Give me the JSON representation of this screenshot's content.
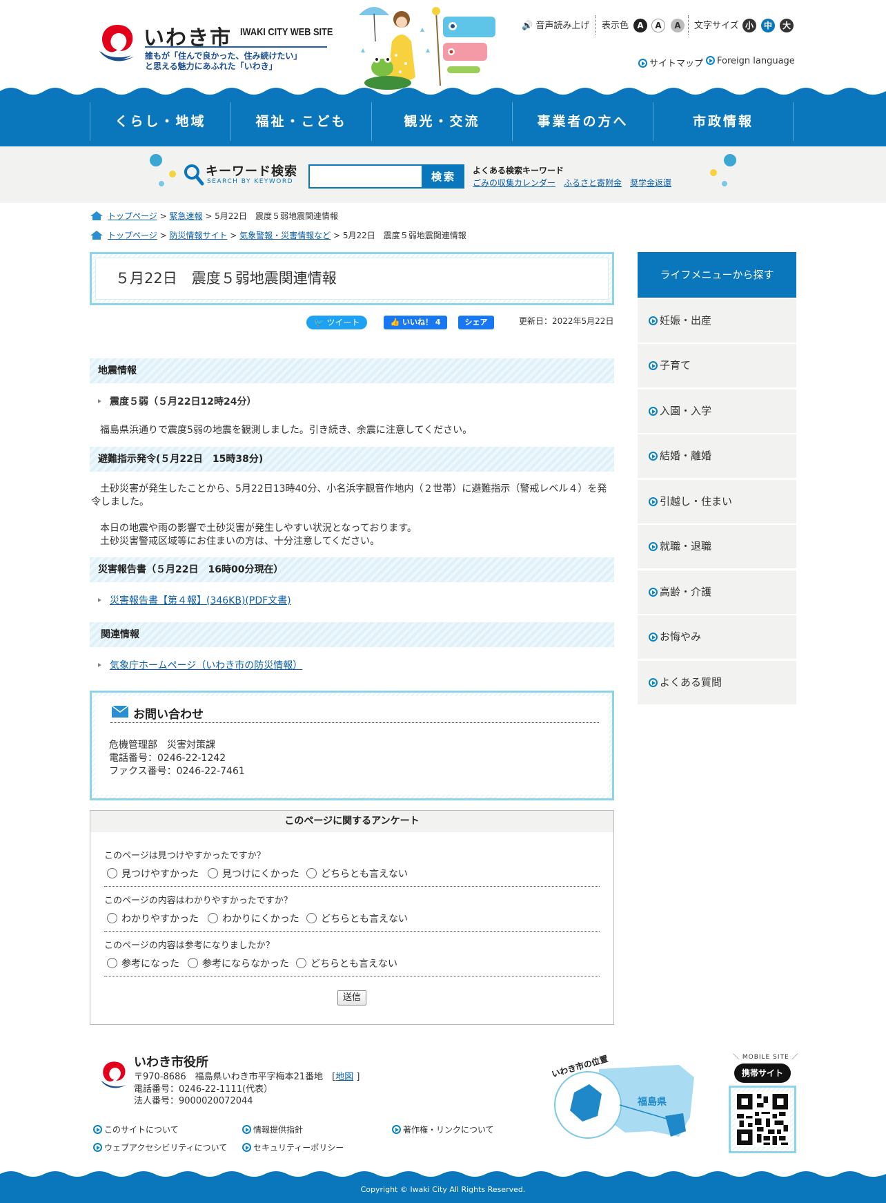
{
  "header": {
    "logo_title": "いわき市",
    "logo_sub": "IWAKI CITY WEB SITE",
    "tagline_1": "誰もが「住んで良かった、住み続けたい」",
    "tagline_2": "と思える魅力にあふれた「いわき」",
    "voice": "音声読み上げ",
    "color_label": "表示色",
    "color_options": [
      "A",
      "A",
      "A"
    ],
    "size_label": "文字サイズ",
    "size_options": [
      "小",
      "中",
      "大"
    ],
    "sitemap": "サイトマップ",
    "foreign": "Foreign language"
  },
  "gnav": [
    "くらし・地域",
    "福祉・こども",
    "観光・交流",
    "事業者の方へ",
    "市政情報"
  ],
  "search": {
    "title": "キーワード検索",
    "sub": "SEARCH BY KEYWORD",
    "input_value": "",
    "button": "検索",
    "keywords_head": "よくある検索キーワード",
    "keywords": [
      "ごみの収集カレンダー",
      "ふるさと寄附金",
      "奨学金返還"
    ]
  },
  "breadcrumbs": {
    "trail1": {
      "home": "トップページ",
      "links": [
        "緊急速報"
      ],
      "current": "5月22日　震度５弱地震関連情報"
    },
    "trail2": {
      "home": "トップページ",
      "links": [
        "防災情報サイト",
        "気象警報・災害情報など"
      ],
      "current": "5月22日　震度５弱地震関連情報"
    },
    "sep": " > "
  },
  "article": {
    "title": "５月22日　震度５弱地震関連情報",
    "tweet": "ツイート",
    "like": "いいね！ 4",
    "share": "シェア",
    "updated": "更新日：2022年5月22日",
    "sec1_head": "地震情報",
    "sec1_bullet": "震度５弱（５月22日12時24分）",
    "sec1_text": "福島県浜通りで震度5弱の地震を観測しました。引き続き、余震に注意してください。",
    "sec2_head": "避難指示発令(５月22日　15時38分)",
    "sec2_text1": "土砂災害が発生したことから、5月22日13時40分、小名浜字観音作地内（２世帯）に避難指示（警戒レベル４）を発令しました。",
    "sec2_text2": "本日の地震や雨の影響で土砂災害が発生しやすい状況となっております。",
    "sec2_text3": "土砂災害警戒区域等にお住まいの方は、十分注意してください。",
    "sec3_head": "災害報告書（５月22日　16時00分現在）",
    "sec3_link": "災害報告書【第４報】(346KB)(PDF文書)",
    "sec4_head": "関連情報",
    "sec4_link": "気象庁ホームページ（いわき市の防災情報）"
  },
  "contact": {
    "title": "お問い合わせ",
    "dept": "危機管理部　災害対策課",
    "tel": "電話番号：0246-22-1242",
    "fax": "ファクス番号：0246-22-7461"
  },
  "survey": {
    "title": "このページに関するアンケート",
    "questions": [
      {
        "q": "このページは見つけやすかったですか？",
        "options": [
          "見つけやすかった",
          "見つけにくかった",
          "どちらとも言えない"
        ]
      },
      {
        "q": "このページの内容はわかりやすかったですか？",
        "options": [
          "わかりやすかった",
          "わかりにくかった",
          "どちらとも言えない"
        ]
      },
      {
        "q": "このページの内容は参考になりましたか？",
        "options": [
          "参考になった",
          "参考にならなかった",
          "どちらとも言えない"
        ]
      }
    ],
    "submit": "送信"
  },
  "sidebar": {
    "head": "ライフメニューから探す",
    "items": [
      "妊娠・出産",
      "子育て",
      "入園・入学",
      "結婚・離婚",
      "引越し・住まい",
      "就職・退職",
      "高齢・介護",
      "お悔やみ",
      "よくある質問"
    ]
  },
  "footer": {
    "name": "いわき市役所",
    "address": "〒970-8686　福島県いわき市平字梅本21番地　[",
    "map_link": "地図",
    "address_end": "]",
    "tel": "電話番号：0246-22-1111(代表）",
    "corp": "法人番号：9000020072044",
    "links": [
      "このサイトについて",
      "情報提供指針",
      "著作権・リンクについて",
      "ウェブアクセシビリティについて",
      "セキュリティーポリシー"
    ],
    "map_caption": "いわき市の位置",
    "pref_label": "福島県",
    "mobile_label": "＼ MOBILE SITE ／",
    "mobile_bubble": "携帯サイト",
    "copyright": "Copyright © Iwaki City All Rights Reserved."
  },
  "colors": {
    "brand_blue": "#0a77bd",
    "light_cyan": "#8fd3ea",
    "band_gray": "#f2f2f0"
  }
}
